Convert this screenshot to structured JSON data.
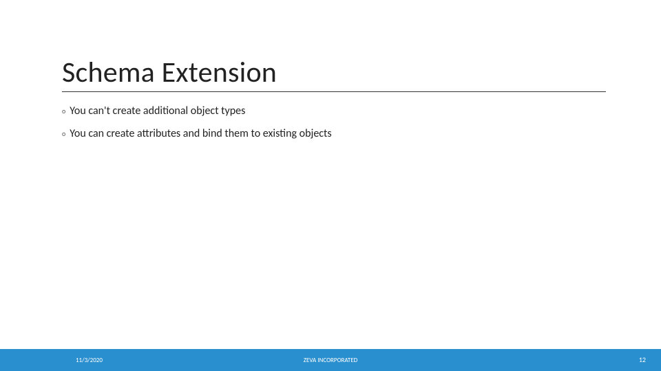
{
  "title": "Schema Extension",
  "bullets": [
    {
      "marker": "o",
      "text": "You can't create additional object types"
    },
    {
      "marker": "o",
      "text": "You can create attributes and bind them to existing objects"
    }
  ],
  "footer": {
    "date": "11/3/2020",
    "center": "ZEVA INCORPORATED",
    "page": "12"
  }
}
